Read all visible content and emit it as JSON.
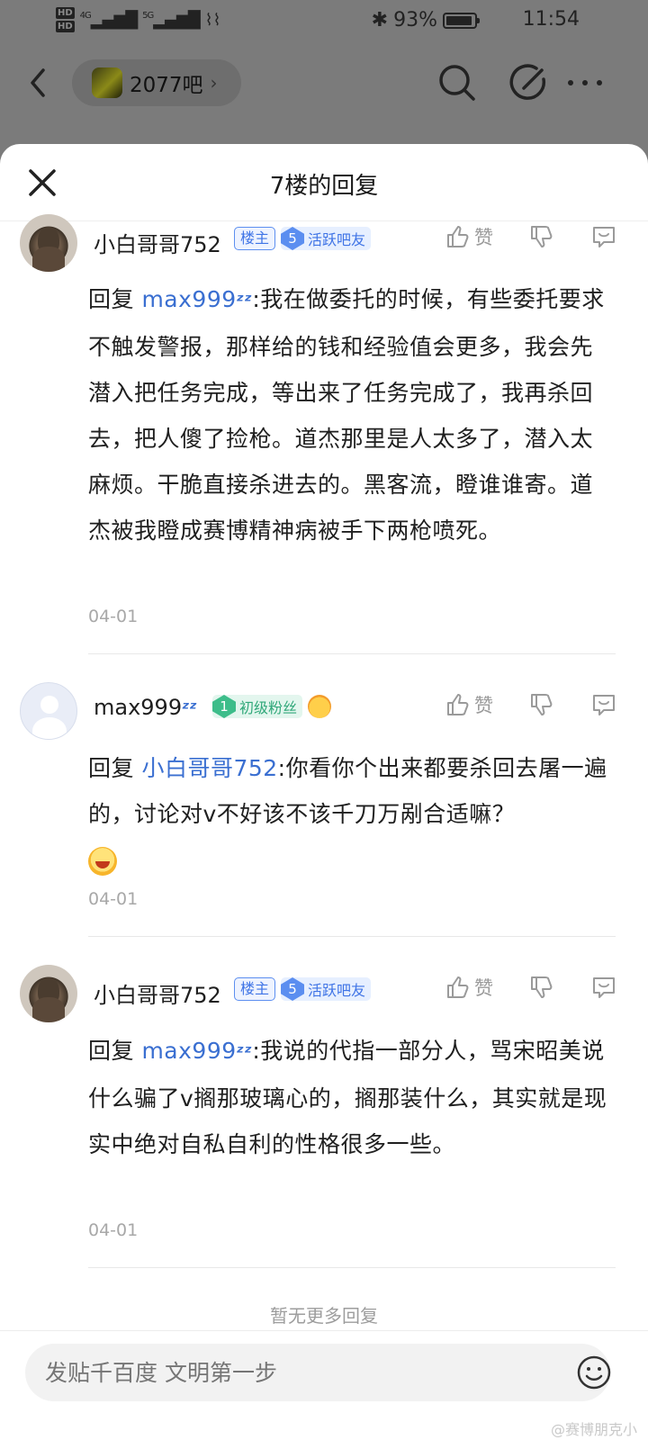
{
  "status_bar": {
    "hd_1": "HD",
    "hd_2": "HD",
    "signal_1": "4G",
    "signal_2": "5G",
    "battery": "93%",
    "battery_level": 0.93,
    "time": "11:54"
  },
  "top_nav": {
    "forum_name": "2077吧",
    "forum_arrow": "›"
  },
  "sheet": {
    "title": "7楼的回复"
  },
  "replies": [
    {
      "user": "小白哥哥752",
      "owner_badge": "楼主",
      "level": "5",
      "level_title": "活跃吧友",
      "like_label": "赞",
      "reply_prefix": "回复 ",
      "mention": "max999",
      "mention_suffix": "💤",
      "text": ":我在做委托的时候，有些委托要求不触发警报，那样给的钱和经验值会更多，我会先潜入把任务完成，等出来了任务完成了，我再杀回去，把人傻了捡枪。道杰那里是人太多了，潜入太麻烦。干脆直接杀进去的。黑客流，瞪谁谁寄。道杰被我瞪成赛博精神病被手下两枪喷死。",
      "date": "04-01"
    },
    {
      "user": "max999",
      "user_suffix": "💤",
      "level": "1",
      "level_title": "初级粉丝",
      "like_label": "赞",
      "reply_prefix": "回复 ",
      "mention": "小白哥哥752",
      "text": ":你看你个出来都要杀回去屠一遍的，讨论对v不好该不该千刀万剐合适嘛？",
      "date": "04-01"
    },
    {
      "user": "小白哥哥752",
      "owner_badge": "楼主",
      "level": "5",
      "level_title": "活跃吧友",
      "like_label": "赞",
      "reply_prefix": "回复 ",
      "mention": "max999",
      "mention_suffix": "💤",
      "text": ":我说的代指一部分人，骂宋昭美说什么骗了v搁那玻璃心的，搁那装什么，其实就是现实中绝对自私自利的性格很多一些。",
      "date": "04-01"
    }
  ],
  "footer": {
    "no_more": "暂无更多回复",
    "input_placeholder": "发贴千百度 文明第一步",
    "watermark": "@赛博朋克小"
  },
  "colors": {
    "accent": "#3a6fd1",
    "owner_badge": "#3f74e6",
    "green_badge": "#31a87a",
    "overlay": "#7b7b7b"
  },
  "icons": [
    "back-icon",
    "search-icon",
    "edit-icon",
    "more-icon",
    "close-icon",
    "thumb-up-icon",
    "thumb-down-icon",
    "comment-icon",
    "smile-icon"
  ]
}
